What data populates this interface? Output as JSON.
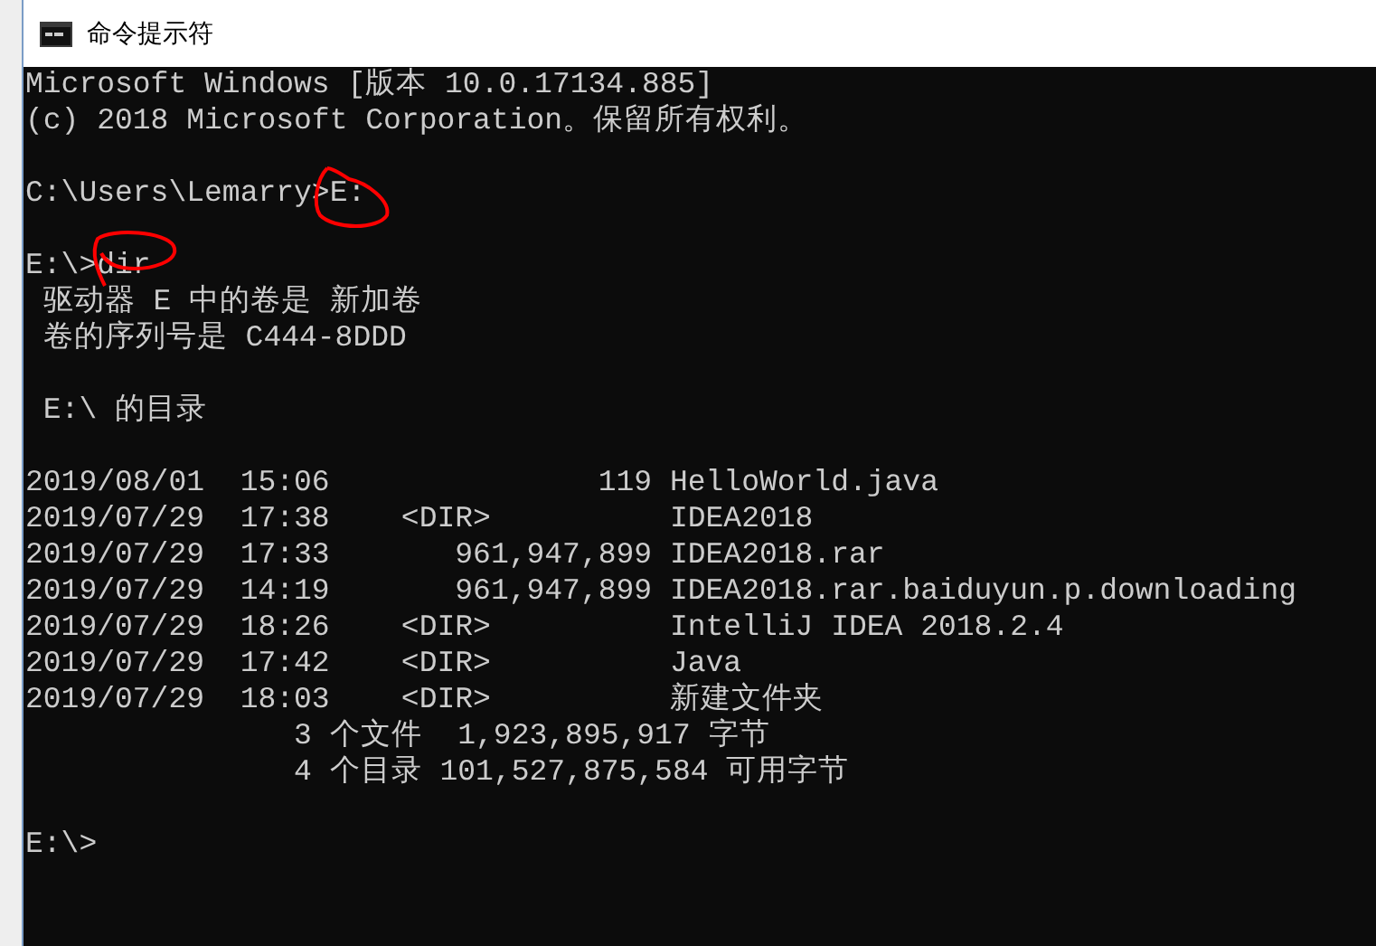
{
  "window": {
    "title": "命令提示符"
  },
  "console": {
    "lines": [
      {
        "kind": "text",
        "text": "Microsoft Windows [版本 10.0.17134.885]"
      },
      {
        "kind": "text",
        "text": "(c) 2018 Microsoft Corporation。保留所有权利。"
      },
      {
        "kind": "blank"
      },
      {
        "kind": "text",
        "text": "C:\\Users\\Lemarry>E:"
      },
      {
        "kind": "blank"
      },
      {
        "kind": "text",
        "text": "E:\\>dir"
      },
      {
        "kind": "text",
        "text": " 驱动器 E 中的卷是 新加卷"
      },
      {
        "kind": "text",
        "text": " 卷的序列号是 C444-8DDD"
      },
      {
        "kind": "blank"
      },
      {
        "kind": "text",
        "text": " E:\\ 的目录"
      },
      {
        "kind": "blank"
      },
      {
        "kind": "text",
        "text": "2019/08/01  15:06               119 HelloWorld.java"
      },
      {
        "kind": "text",
        "text": "2019/07/29  17:38    <DIR>          IDEA2018"
      },
      {
        "kind": "text",
        "text": "2019/07/29  17:33       961,947,899 IDEA2018.rar"
      },
      {
        "kind": "text",
        "text": "2019/07/29  14:19       961,947,899 IDEA2018.rar.baiduyun.p.downloading"
      },
      {
        "kind": "text",
        "text": "2019/07/29  18:26    <DIR>          IntelliJ IDEA 2018.2.4"
      },
      {
        "kind": "text",
        "text": "2019/07/29  17:42    <DIR>          Java"
      },
      {
        "kind": "text",
        "text": "2019/07/29  18:03    <DIR>          新建文件夹"
      },
      {
        "kind": "text",
        "text": "               3 个文件  1,923,895,917 字节"
      },
      {
        "kind": "text",
        "text": "               4 个目录 101,527,875,584 可用字节"
      },
      {
        "kind": "blank"
      },
      {
        "kind": "text",
        "text": "E:\\>"
      }
    ]
  }
}
